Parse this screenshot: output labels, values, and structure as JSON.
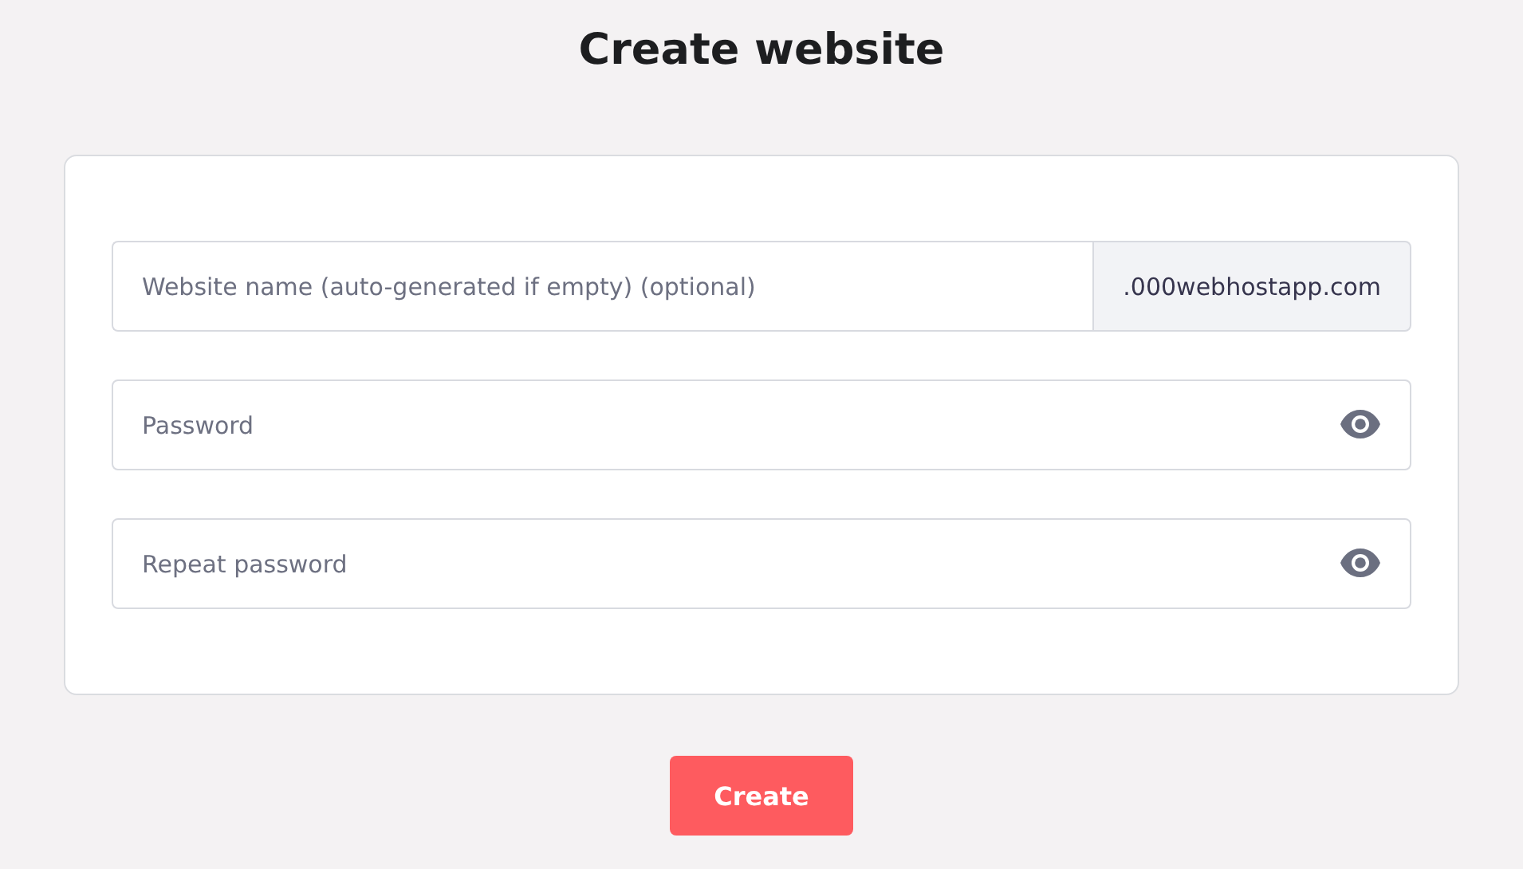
{
  "title": "Create website",
  "fields": [
    {
      "kind": "domain",
      "placeholder": "Website name (auto-generated if empty) (optional)",
      "suffix": ".000webhostapp.com"
    },
    {
      "kind": "password",
      "placeholder": "Password"
    },
    {
      "kind": "password",
      "placeholder": "Repeat password"
    }
  ],
  "button": "Create"
}
